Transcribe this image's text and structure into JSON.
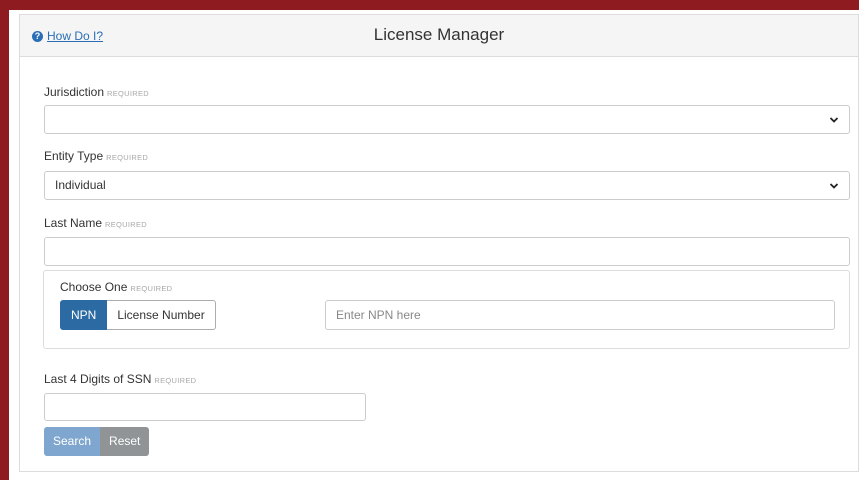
{
  "header": {
    "help_label": "How Do I?",
    "help_icon": "question-circle-icon",
    "title": "License Manager"
  },
  "required_tag": "REQUIRED",
  "jurisdiction": {
    "label": "Jurisdiction",
    "value": ""
  },
  "entity_type": {
    "label": "Entity Type",
    "value": "Individual"
  },
  "last_name": {
    "label": "Last Name",
    "value": ""
  },
  "choose_one": {
    "label": "Choose One",
    "options": [
      "NPN",
      "License Number"
    ],
    "selected": "NPN",
    "input_placeholder": "Enter NPN here"
  },
  "ssn": {
    "label": "Last 4 Digits of SSN",
    "value": ""
  },
  "actions": {
    "search_label": "Search",
    "reset_label": "Reset"
  },
  "colors": {
    "frame": "#8e1b1f",
    "accent": "#2c6aa3",
    "link": "#2a6fb5",
    "search_button": "#7fa6cf",
    "reset_button": "#909496"
  }
}
